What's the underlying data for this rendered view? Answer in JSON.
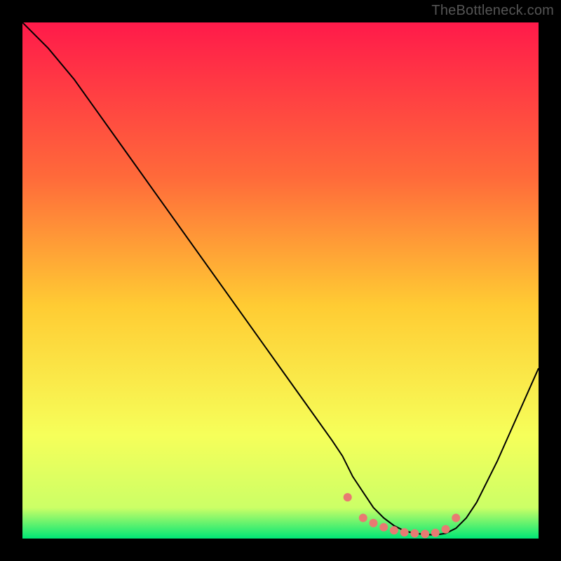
{
  "watermark": "TheBottleneck.com",
  "chart_data": {
    "type": "line",
    "title": "",
    "xlabel": "",
    "ylabel": "",
    "xlim": [
      0,
      100
    ],
    "ylim": [
      0,
      100
    ],
    "grid": false,
    "legend": false,
    "background_gradient": {
      "stops": [
        {
          "offset": 0.0,
          "color": "#ff1a4a"
        },
        {
          "offset": 0.3,
          "color": "#ff6a3a"
        },
        {
          "offset": 0.55,
          "color": "#ffcc33"
        },
        {
          "offset": 0.8,
          "color": "#f6ff5a"
        },
        {
          "offset": 0.94,
          "color": "#ccff66"
        },
        {
          "offset": 1.0,
          "color": "#00e676"
        }
      ]
    },
    "series": [
      {
        "name": "curve",
        "color": "#000000",
        "stroke_width": 2,
        "x": [
          0,
          5,
          10,
          15,
          20,
          25,
          30,
          35,
          40,
          45,
          50,
          55,
          60,
          62,
          64,
          66,
          68,
          70,
          72,
          74,
          76,
          78,
          80,
          82,
          84,
          86,
          88,
          90,
          92,
          94,
          96,
          98,
          100
        ],
        "y": [
          100,
          95,
          89,
          82,
          75,
          68,
          61,
          54,
          47,
          40,
          33,
          26,
          19,
          16,
          12,
          9,
          6,
          4,
          2.5,
          1.5,
          1.0,
          0.8,
          0.7,
          1.0,
          2.0,
          4.0,
          7.0,
          11.0,
          15.0,
          19.5,
          24.0,
          28.5,
          33.0
        ]
      },
      {
        "name": "marker-band",
        "type": "scatter",
        "color": "#e87a72",
        "marker_radius": 6,
        "x": [
          63,
          66,
          68,
          70,
          72,
          74,
          76,
          78,
          80,
          82,
          84
        ],
        "y": [
          8,
          4,
          3,
          2.2,
          1.6,
          1.2,
          1.0,
          0.9,
          1.1,
          1.8,
          4.0
        ]
      }
    ]
  }
}
